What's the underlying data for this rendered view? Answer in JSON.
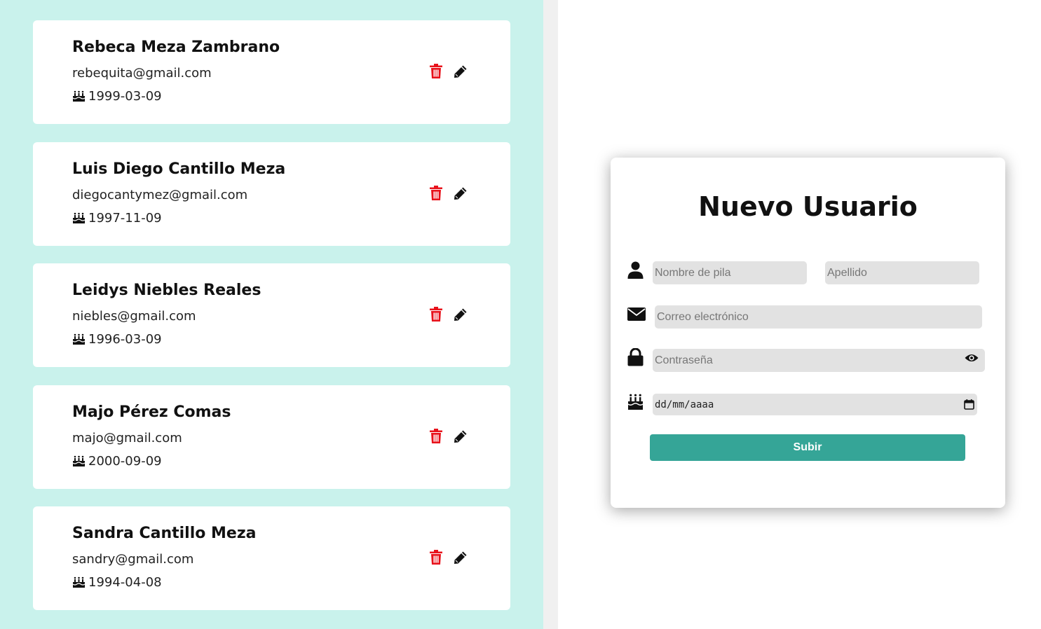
{
  "users": [
    {
      "name": "Rebeca Meza Zambrano",
      "email": "rebequita@gmail.com",
      "birthdate": "1999-03-09"
    },
    {
      "name": "Luis Diego Cantillo Meza",
      "email": "diegocantymez@gmail.com",
      "birthdate": "1997-11-09"
    },
    {
      "name": "Leidys Niebles Reales",
      "email": "niebles@gmail.com",
      "birthdate": "1996-03-09"
    },
    {
      "name": "Majo Pérez Comas",
      "email": "majo@gmail.com",
      "birthdate": "2000-09-09"
    },
    {
      "name": "Sandra Cantillo Meza",
      "email": "sandry@gmail.com",
      "birthdate": "1994-04-08"
    }
  ],
  "icons": {
    "card_delete": "trash-icon",
    "card_edit": "pencil-icon",
    "card_birthday": "cake-icon",
    "form_user": "user-icon",
    "form_email": "envelope-icon",
    "form_password": "lock-icon",
    "form_birthday": "cake-icon",
    "password_toggle": "eye-icon"
  },
  "form": {
    "title": "Nuevo Usuario",
    "first_name_placeholder": "Nombre de pila",
    "last_name_placeholder": "Apellido",
    "email_placeholder": "Correo electrónico",
    "password_placeholder": "Contraseña",
    "date_placeholder": "dd/mm/aaaa",
    "submit_label": "Subir"
  },
  "colors": {
    "left_background": "#c9f2ec",
    "delete_icon": "#e8121b",
    "submit_button": "#35a597",
    "input_background": "#e2e2e2"
  }
}
